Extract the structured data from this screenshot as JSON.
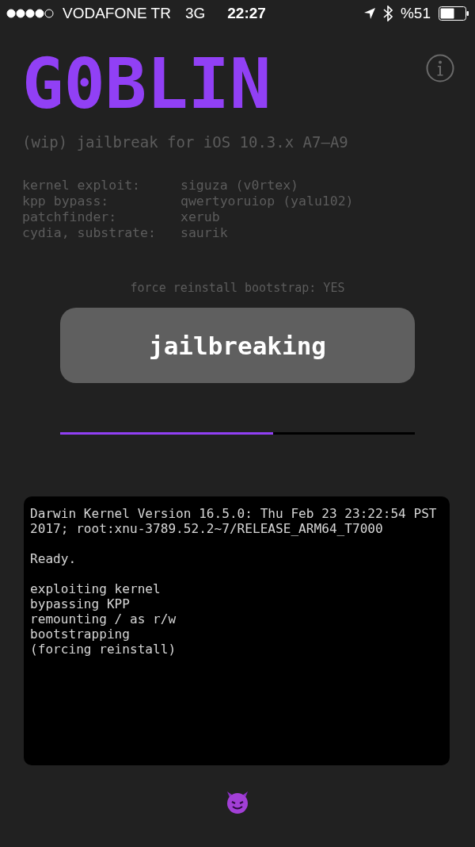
{
  "status_bar": {
    "carrier": "VODAFONE TR",
    "network": "3G",
    "time": "22:27",
    "battery": "%51"
  },
  "header": {
    "title": "G0BLIN",
    "subtitle": "(wip) jailbreak for iOS 10.3.x A7–A9"
  },
  "credits": [
    {
      "label": "kernel exploit:",
      "value": "siguza (v0rtex)"
    },
    {
      "label": "kpp bypass:",
      "value": "qwertyoruiop (yalu102)"
    },
    {
      "label": "patchfinder:",
      "value": "xerub"
    },
    {
      "label": "cydia, substrate:",
      "value": "saurik"
    }
  ],
  "option": "force reinstall bootstrap: YES",
  "button": {
    "label": "jailbreaking",
    "disabled": true
  },
  "progress": {
    "level": 0.6
  },
  "log": [
    [
      "Darwin Kernel Version 16.5.0: Thu Feb 23 23:22:54 PST 2017; root:xnu-3789.52.2~7/RELEASE_ARM64_T7000"
    ],
    [
      "Ready."
    ],
    [
      "exploiting kernel",
      "bypassing KPP",
      "remounting / as r/w",
      "bootstrapping",
      "(forcing reinstall)"
    ]
  ]
}
